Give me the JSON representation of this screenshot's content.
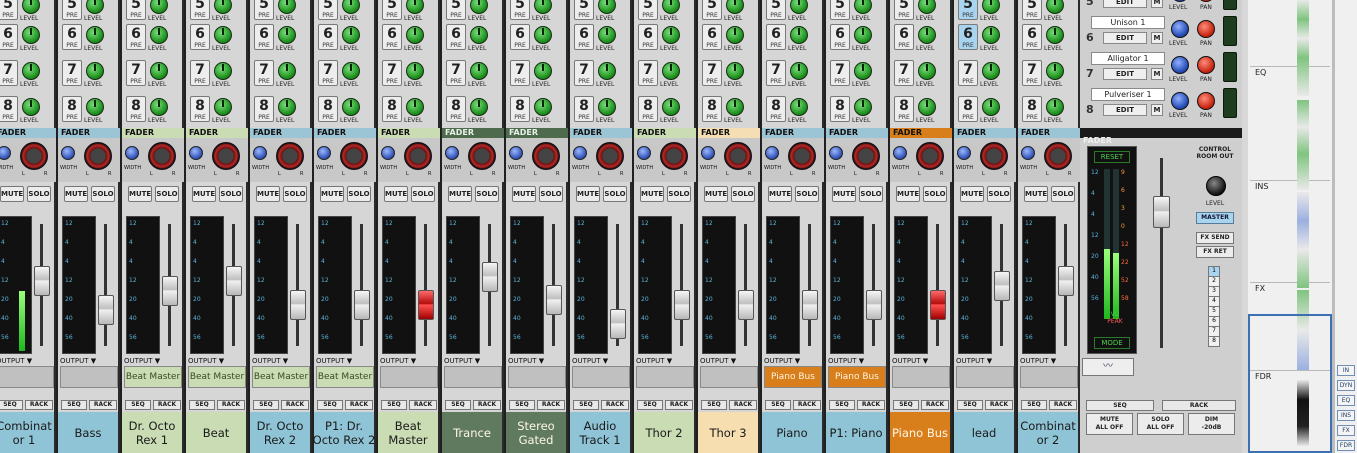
{
  "labels": {
    "pre": "PRE",
    "level": "LEVEL",
    "fader": "FADER",
    "width": "WIDTH",
    "l": "L",
    "r": "R",
    "mute": "MUTE",
    "solo": "SOLO",
    "output": "OUTPUT ▼",
    "seq": "SEQ",
    "rack": "RACK",
    "pan": "PAN"
  },
  "send_numbers": [
    "5",
    "6",
    "7",
    "8"
  ],
  "meter_scale": [
    "12",
    "4",
    "4",
    "12",
    "20",
    "40",
    "56"
  ],
  "channels": [
    {
      "name": "Combinat\nor 1",
      "header_color": "#9bc4d4",
      "name_bg": "#8fc4d6",
      "output_bus": "",
      "bus_style": "",
      "fader_pos": 0.55,
      "fader_red": false
    },
    {
      "name": "Bass",
      "header_color": "#9bc4d4",
      "name_bg": "#8fc4d6",
      "output_bus": "",
      "bus_style": "",
      "fader_pos": 0.25,
      "fader_red": false
    },
    {
      "name": "Dr. Octo\nRex 1",
      "header_color": "#c9dcb3",
      "name_bg": "#c9dcb3",
      "output_bus": "Beat Master",
      "bus_style": "bm",
      "fader_pos": 0.45,
      "fader_red": false
    },
    {
      "name": "Beat",
      "header_color": "#c9dcb3",
      "name_bg": "#c9dcb3",
      "output_bus": "Beat Master",
      "bus_style": "bm",
      "fader_pos": 0.55,
      "fader_red": false
    },
    {
      "name": "Dr. Octo\nRex 2",
      "header_color": "#9bc4d4",
      "name_bg": "#8fc4d6",
      "output_bus": "Beat Master",
      "bus_style": "bm",
      "fader_pos": 0.3,
      "fader_red": false
    },
    {
      "name": "P1: Dr.\nOcto Rex 2",
      "header_color": "#9bc4d4",
      "name_bg": "#8fc4d6",
      "output_bus": "Beat Master",
      "bus_style": "bm",
      "fader_pos": 0.3,
      "fader_red": false
    },
    {
      "name": "Beat\nMaster",
      "header_color": "#c9dcb3",
      "name_bg": "#c9dcb3",
      "output_bus": "",
      "bus_style": "",
      "fader_pos": 0.3,
      "fader_red": true
    },
    {
      "name": "Trance",
      "header_color": "#4e6b4e",
      "name_bg": "#5f7a5f",
      "output_bus": "",
      "bus_style": "",
      "fader_pos": 0.6,
      "fader_red": false
    },
    {
      "name": "Stereo\nGated",
      "header_color": "#4e6b4e",
      "name_bg": "#5f7a5f",
      "output_bus": "",
      "bus_style": "",
      "fader_pos": 0.35,
      "fader_red": false
    },
    {
      "name": "Audio\nTrack 1",
      "header_color": "#9bc4d4",
      "name_bg": "#8fc4d6",
      "output_bus": "",
      "bus_style": "",
      "fader_pos": 0.1,
      "fader_red": false
    },
    {
      "name": "Thor 2",
      "header_color": "#c9dcb3",
      "name_bg": "#c9dcb3",
      "output_bus": "",
      "bus_style": "",
      "fader_pos": 0.3,
      "fader_red": false
    },
    {
      "name": "Thor 3",
      "header_color": "#f5deb3",
      "name_bg": "#f7deb1",
      "output_bus": "",
      "bus_style": "",
      "fader_pos": 0.3,
      "fader_red": false
    },
    {
      "name": "Piano",
      "header_color": "#9bc4d4",
      "name_bg": "#8fc4d6",
      "output_bus": "Piano Bus",
      "bus_style": "pb",
      "fader_pos": 0.3,
      "fader_red": false
    },
    {
      "name": "P1: Piano",
      "header_color": "#9bc4d4",
      "name_bg": "#8fc4d6",
      "output_bus": "Piano Bus",
      "bus_style": "pb",
      "fader_pos": 0.3,
      "fader_red": false
    },
    {
      "name": "Piano Bus",
      "header_color": "#d87f1c",
      "name_bg": "#d87f1c",
      "output_bus": "",
      "bus_style": "",
      "fader_pos": 0.3,
      "fader_red": true
    },
    {
      "name": "lead",
      "header_color": "#9bc4d4",
      "name_bg": "#8fc4d6",
      "output_bus": "",
      "bus_style": "",
      "fader_pos": 0.5,
      "fader_red": false
    },
    {
      "name": "Combinat\nor 2",
      "header_color": "#9bc4d4",
      "name_bg": "#8fc4d6",
      "output_bus": "",
      "bus_style": "",
      "fader_pos": 0.55,
      "fader_red": false
    }
  ],
  "master": {
    "fader_label": "FADER",
    "fx_slots": [
      {
        "num": "5",
        "name": "",
        "edit": "EDIT",
        "m": "M"
      },
      {
        "num": "6",
        "name": "Unison 1",
        "edit": "EDIT",
        "m": "M"
      },
      {
        "num": "7",
        "name": "Alligator 1",
        "edit": "EDIT",
        "m": "M"
      },
      {
        "num": "8",
        "name": "Pulveriser 1",
        "edit": "EDIT",
        "m": "M"
      }
    ],
    "reset": "RESET",
    "vu_label": "VU",
    "peak_label": "PEAK",
    "mode": "MODE",
    "left_scale": [
      "12",
      "4",
      "4",
      "12",
      "20",
      "40",
      "56"
    ],
    "right_scale": [
      "9",
      "6",
      "3",
      "0",
      "12",
      "22",
      "52",
      "58"
    ],
    "control_room_out": "CONTROL ROOM OUT",
    "level": "LEVEL",
    "master_btn": "MASTER",
    "fx_send": "FX SEND",
    "fx_ret": "FX RET",
    "numbers": [
      "1",
      "2",
      "3",
      "4",
      "5",
      "6",
      "7",
      "8"
    ],
    "seq": "SEQ",
    "rack": "RACK",
    "mute_all": "MUTE\nALL OFF",
    "solo_all": "SOLO\nALL OFF",
    "dim": "DIM\n-20dB"
  },
  "right_panel": {
    "sections": [
      "EQ",
      "INS",
      "FX",
      "FDR"
    ],
    "tabs": [
      "IN",
      "DYN",
      "EQ",
      "INS",
      "FX",
      "FDR"
    ]
  }
}
